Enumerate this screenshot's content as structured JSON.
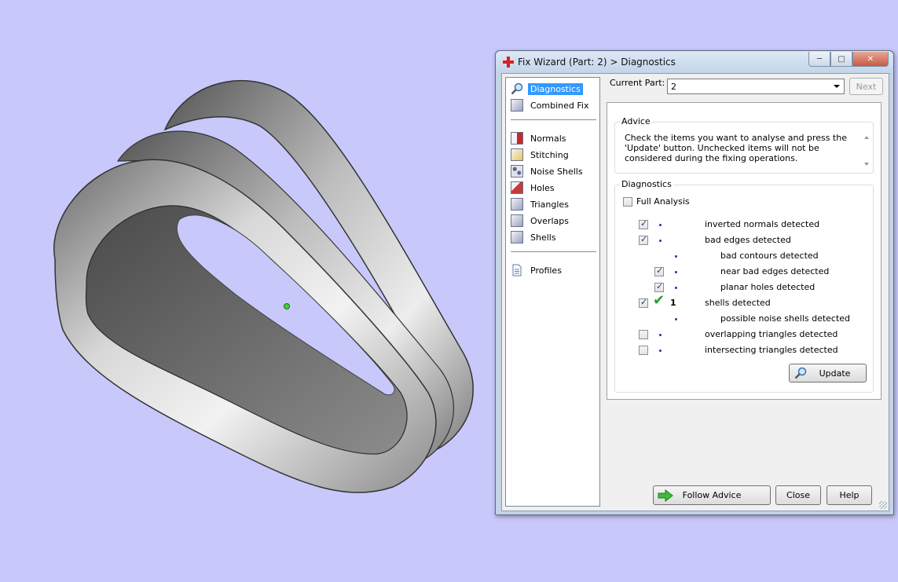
{
  "window": {
    "title": "Fix Wizard (Part: 2) > Diagnostics"
  },
  "nav": {
    "items": [
      {
        "label": "Diagnostics",
        "icon": "magnifier-icon",
        "selected": true
      },
      {
        "label": "Combined Fix",
        "icon": "combined-fix-icon"
      },
      {
        "label": "Normals",
        "icon": "normals-icon"
      },
      {
        "label": "Stitching",
        "icon": "stitching-icon"
      },
      {
        "label": "Noise Shells",
        "icon": "noise-shells-icon"
      },
      {
        "label": "Holes",
        "icon": "holes-icon"
      },
      {
        "label": "Triangles",
        "icon": "triangles-icon"
      },
      {
        "label": "Overlaps",
        "icon": "overlaps-icon"
      },
      {
        "label": "Shells",
        "icon": "shells-icon"
      },
      {
        "label": "Profiles",
        "icon": "document-icon"
      }
    ]
  },
  "part": {
    "label": "Current Part:",
    "value": "2",
    "next_label": "Next"
  },
  "advice": {
    "title": "Advice",
    "text": "Check the items you want to analyse and press the 'Update' button. Unchecked items will not be considered during the fixing operations."
  },
  "diagnostics": {
    "title": "Diagnostics",
    "full_analysis_label": "Full Analysis",
    "full_analysis_checked": false,
    "rows": [
      {
        "label": "inverted normals detected",
        "checked": true
      },
      {
        "label": "bad edges detected",
        "checked": true
      },
      {
        "label": "bad contours detected"
      },
      {
        "label": "near bad edges detected",
        "checked": true
      },
      {
        "label": "planar holes detected",
        "checked": true
      },
      {
        "label": "shells detected",
        "checked": true,
        "count": "1",
        "status": "ok"
      },
      {
        "label": "possible noise shells detected"
      },
      {
        "label": "overlapping triangles detected",
        "checked": false
      },
      {
        "label": "intersecting triangles detected",
        "checked": false
      }
    ],
    "update_label": "Update"
  },
  "footer": {
    "follow_advice_label": "Follow Advice",
    "close_label": "Close",
    "help_label": "Help"
  },
  "colors": {
    "viewport_background": "#c8c8fb",
    "selection": "#3399ff",
    "ok_tick": "#2b9a3a"
  }
}
